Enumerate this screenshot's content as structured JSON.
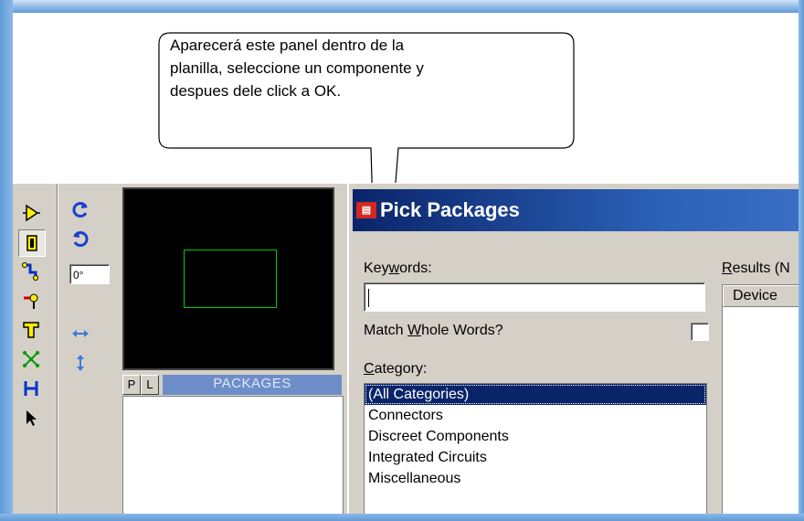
{
  "callout": {
    "line1": "Aparecerá este panel dentro de la",
    "line2": "planilla, seleccione un componente y",
    "line3": "despues dele click a OK."
  },
  "editor": {
    "angle_value": "0°",
    "packages_tab_p": "P",
    "packages_tab_l": "L",
    "packages_label": "PACKAGES"
  },
  "dialog": {
    "icon_text": "ISIS",
    "title": "Pick Packages",
    "keywords_label": {
      "prefix": "Key",
      "underlined": "w",
      "suffix": "ords:"
    },
    "keywords_value": "",
    "match_label": {
      "prefix": "Match ",
      "underlined": "W",
      "suffix": "hole Words?"
    },
    "category_label": {
      "prefix": "",
      "underlined": "C",
      "suffix": "ategory:"
    },
    "categories": [
      "(All Categories)",
      "Connectors",
      "Discreet Components",
      "Integrated Circuits",
      "Miscellaneous"
    ],
    "selected_category": "(All Categories)",
    "results_label": {
      "prefix": "",
      "underlined": "R",
      "suffix": "esults (N"
    },
    "results_column": "Device"
  },
  "colors": {
    "title_bar": "#0a246a",
    "selection": "#0a246a",
    "preview_outline": "#00cc00",
    "packages_header": "#6d8ec9"
  },
  "toolbar_icons": [
    "component-mode-icon",
    "package-mode-icon",
    "track-mode-icon",
    "via-mode-icon",
    "pad-mode-icon",
    "ratsnest-icon",
    "connectivity-highlight-icon",
    "selection-arrow-icon",
    "rotate-clockwise-icon",
    "rotate-anticlockwise-icon",
    "mirror-horizontal-icon",
    "mirror-vertical-icon"
  ]
}
